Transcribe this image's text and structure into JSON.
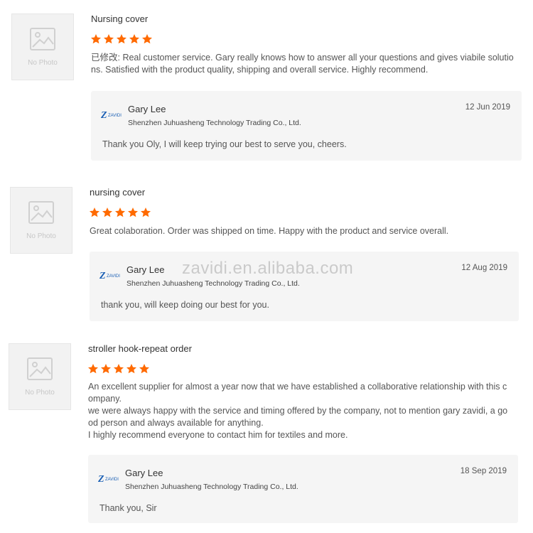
{
  "colors": {
    "star": "#ff6a00",
    "reply_bg": "#f5f5f5",
    "text": "#555555"
  },
  "no_photo_label": "No Photo",
  "rating_stars": 5,
  "watermark": "zavidi.en.alibaba.com",
  "reviews": [
    {
      "title": "Nursing cover",
      "text_lines": [
        "已修改: Real customer service. Gary really knows how to answer all your questions and gives viabile solutio",
        "ns. Satisfied with the product quality, shipping and overall service. Highly recommend."
      ],
      "reply": {
        "logo_text": "ZAVIDI",
        "name": "Gary Lee",
        "company": "Shenzhen Juhuasheng Technology Trading Co., Ltd.",
        "date": "12 Jun 2019",
        "message": "Thank you Oly, I will keep trying our best to serve you, cheers."
      }
    },
    {
      "title": "nursing cover",
      "text_lines": [
        "Great colaboration. Order was shipped on time. Happy with the product and service overall."
      ],
      "reply": {
        "logo_text": "ZAVIDI",
        "name": "Gary Lee",
        "company": "Shenzhen Juhuasheng Technology Trading Co., Ltd.",
        "date": "12 Aug 2019",
        "message": "thank you, will keep doing our best for you."
      }
    },
    {
      "title": "stroller hook-repeat order",
      "text_lines": [
        "An excellent supplier for almost a year now that we have established a collaborative relationship with this c",
        "ompany.",
        "we were always happy with the service and timing offered by the company, not to mention gary zavidi, a go",
        "od person and always available for anything.",
        "I highly recommend everyone to contact him for textiles and more."
      ],
      "reply": {
        "logo_text": "ZAVIDI",
        "name": "Gary Lee",
        "company": "Shenzhen Juhuasheng Technology Trading Co., Ltd.",
        "date": "18 Sep 2019",
        "message": "Thank you, Sir"
      }
    }
  ]
}
